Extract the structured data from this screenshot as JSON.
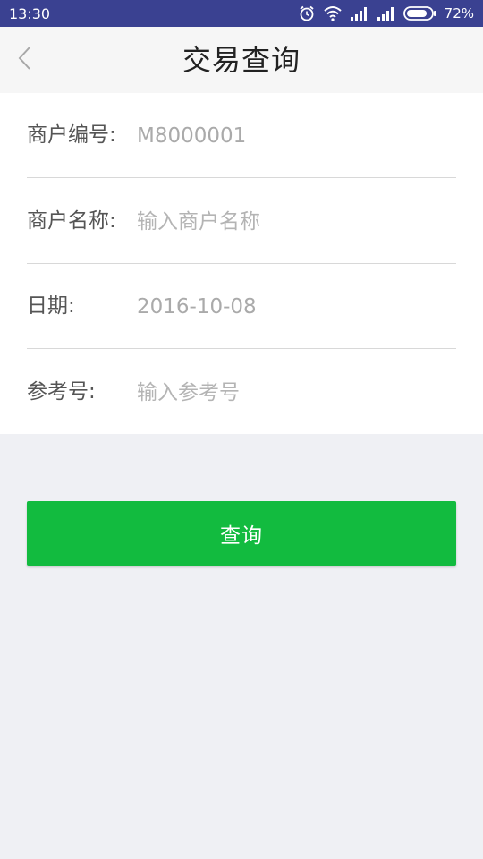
{
  "status_bar": {
    "time": "13:30",
    "battery": "72%",
    "icons": [
      "alarm-icon",
      "wifi-icon",
      "signal-icon",
      "signal-icon",
      "battery-icon"
    ]
  },
  "header": {
    "title": "交易查询",
    "back_icon": "chevron-left-icon"
  },
  "form": {
    "merchant_id": {
      "label": "商户编号:",
      "value": "M8000001"
    },
    "merchant_name": {
      "label": "商户名称:",
      "placeholder": "输入商户名称"
    },
    "date": {
      "label": "日期:",
      "value": "2016-10-08"
    },
    "reference_no": {
      "label": "参考号:",
      "placeholder": "输入参考号"
    }
  },
  "actions": {
    "query_label": "查询"
  },
  "colors": {
    "status_bar": "#3a4191",
    "primary_button": "#12bb3f",
    "background": "#eff0f4"
  }
}
